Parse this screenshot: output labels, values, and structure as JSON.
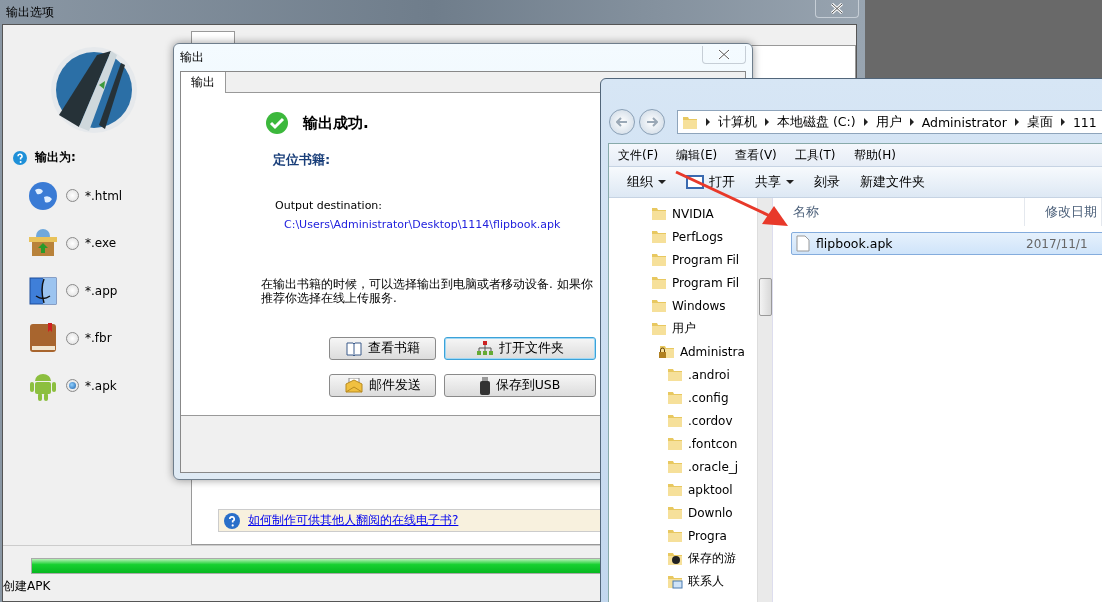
{
  "main_window": {
    "title": "输出选项",
    "output_as_label": "输出为:",
    "formats": [
      {
        "kind": "globe",
        "label": "*.html",
        "selected": false
      },
      {
        "kind": "package",
        "label": "*.exe",
        "selected": false
      },
      {
        "kind": "finder",
        "label": "*.app",
        "selected": false
      },
      {
        "kind": "book",
        "label": "*.fbr",
        "selected": false
      },
      {
        "kind": "android",
        "label": "*.apk",
        "selected": true
      }
    ],
    "help_link": "如何制作可供其他人翻阅的在线电子书?",
    "progress": {
      "level": 1,
      "label": "创建APK"
    }
  },
  "dialog": {
    "title": "输出",
    "tab": "输出",
    "status": "输出成功.",
    "locate_heading": "定位书籍:",
    "destination_label": "Output destination:",
    "destination_path": "C:\\Users\\Administrator\\Desktop\\1114\\flipbook.apk",
    "message": [
      "在输出书籍的时候，可以选择输出到电脑或者移动设备. 如果你",
      "推荐你选择在线上传服务."
    ],
    "buttons": [
      {
        "kind": "book",
        "label": "查看书籍",
        "focused": false
      },
      {
        "kind": "network",
        "label": "打开文件夹",
        "focused": true
      },
      {
        "kind": "mail",
        "label": "邮件发送",
        "focused": false
      },
      {
        "kind": "usb",
        "label": "保存到USB",
        "focused": false
      }
    ]
  },
  "explorer": {
    "breadcrumbs": [
      "计算机",
      "本地磁盘 (C:)",
      "用户",
      "Administrator",
      "桌面",
      "111"
    ],
    "menu": [
      "文件(F)",
      "编辑(E)",
      "查看(V)",
      "工具(T)",
      "帮助(H)"
    ],
    "toolbar": [
      {
        "kind": "dropdown",
        "label": "组织"
      },
      {
        "kind": "open",
        "label": "打开"
      },
      {
        "kind": "dropdown",
        "label": "共享"
      },
      {
        "kind": "plain",
        "label": "刻录"
      },
      {
        "kind": "plain",
        "label": "新建文件夹"
      }
    ],
    "tree": [
      {
        "kind": "folder",
        "label": "NVIDIA"
      },
      {
        "kind": "folder",
        "label": "PerfLogs"
      },
      {
        "kind": "folder",
        "label": "Program Fil"
      },
      {
        "kind": "folder",
        "label": "Program Fil"
      },
      {
        "kind": "folder",
        "label": "Windows"
      },
      {
        "kind": "folder",
        "label": "用户",
        "children": [
          {
            "kind": "locked",
            "label": "Administra",
            "children": [
              {
                "kind": "folder",
                "label": ".androi"
              },
              {
                "kind": "folder",
                "label": ".config"
              },
              {
                "kind": "folder",
                "label": ".cordov"
              },
              {
                "kind": "folder",
                "label": ".fontcon"
              },
              {
                "kind": "folder",
                "label": ".oracle_j"
              },
              {
                "kind": "folder",
                "label": "apktool"
              },
              {
                "kind": "folder",
                "label": "Downlo"
              },
              {
                "kind": "folder",
                "label": "Progra"
              },
              {
                "kind": "games",
                "label": "保存的游"
              },
              {
                "kind": "contacts",
                "label": "联系人"
              }
            ]
          }
        ]
      }
    ],
    "columns": [
      "名称",
      "修改日期"
    ],
    "files": [
      {
        "name": "flipbook.apk",
        "date": "2017/11/1",
        "selected": true
      }
    ]
  }
}
